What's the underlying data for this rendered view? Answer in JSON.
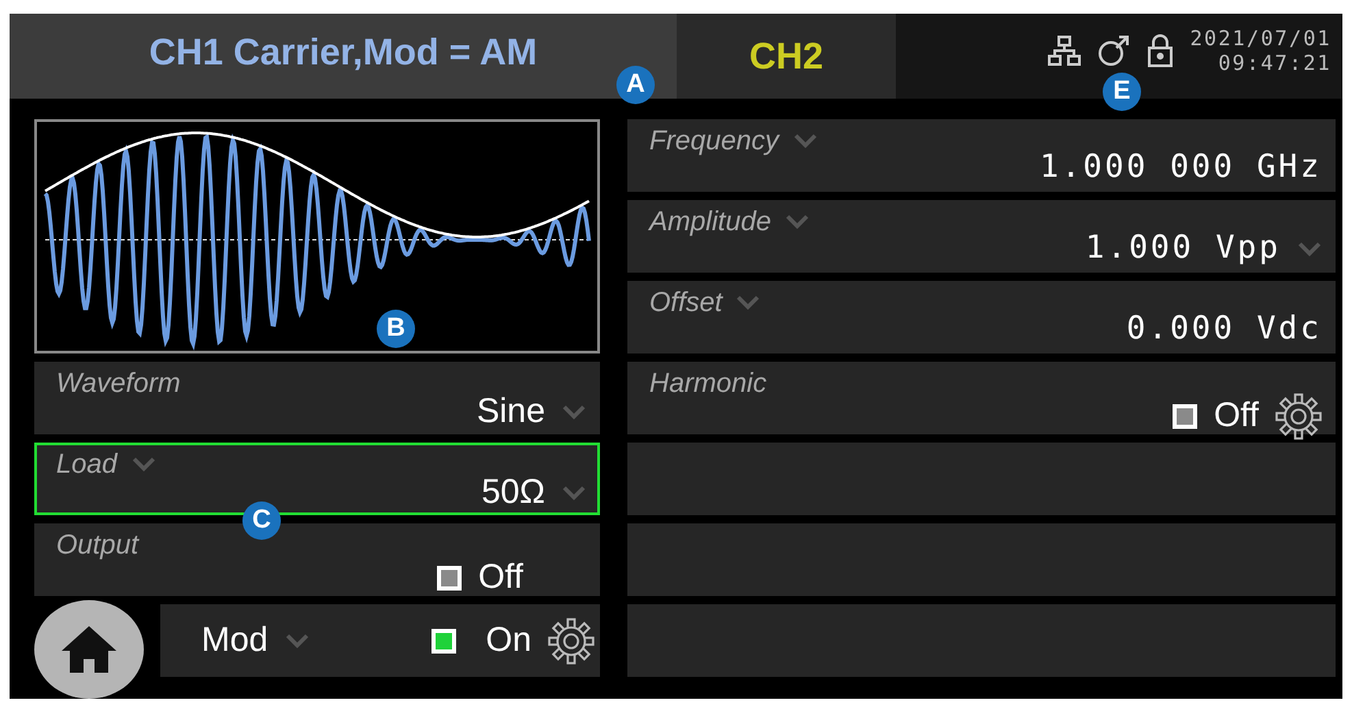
{
  "header": {
    "title": "CH1 Carrier,Mod = AM",
    "channel_tab": "CH2",
    "date": "2021/07/01",
    "time": "09:47:21"
  },
  "left_rows": [
    {
      "kind": "select",
      "label": "Waveform",
      "label_menu": false,
      "value": "Sine",
      "value_menu": true,
      "selected": false
    },
    {
      "kind": "select",
      "label": "Load",
      "label_menu": true,
      "value": "50Ω",
      "value_menu": true,
      "selected": true
    },
    {
      "kind": "toggle",
      "label": "Output",
      "value": "Off",
      "on": false,
      "settings": false,
      "selected": false
    }
  ],
  "mod_bar": {
    "label": "Mod",
    "label_menu": true,
    "value": "On",
    "on": true
  },
  "right_rows": [
    {
      "kind": "select",
      "label": "Frequency",
      "label_menu": true,
      "value": "1.000 000 GHz",
      "value_menu": false,
      "selected": false
    },
    {
      "kind": "select",
      "label": "Amplitude",
      "label_menu": true,
      "value": "1.000 Vpp",
      "value_menu": true,
      "selected": false
    },
    {
      "kind": "select",
      "label": "Offset",
      "label_menu": true,
      "value": "0.000 Vdc",
      "value_menu": false,
      "selected": false
    },
    {
      "kind": "toggle",
      "label": "Harmonic",
      "value": "Off",
      "on": false,
      "settings": true,
      "selected": false
    }
  ],
  "callouts": [
    {
      "label": "A"
    },
    {
      "label": "B"
    },
    {
      "label": "C"
    },
    {
      "label": "E"
    }
  ]
}
